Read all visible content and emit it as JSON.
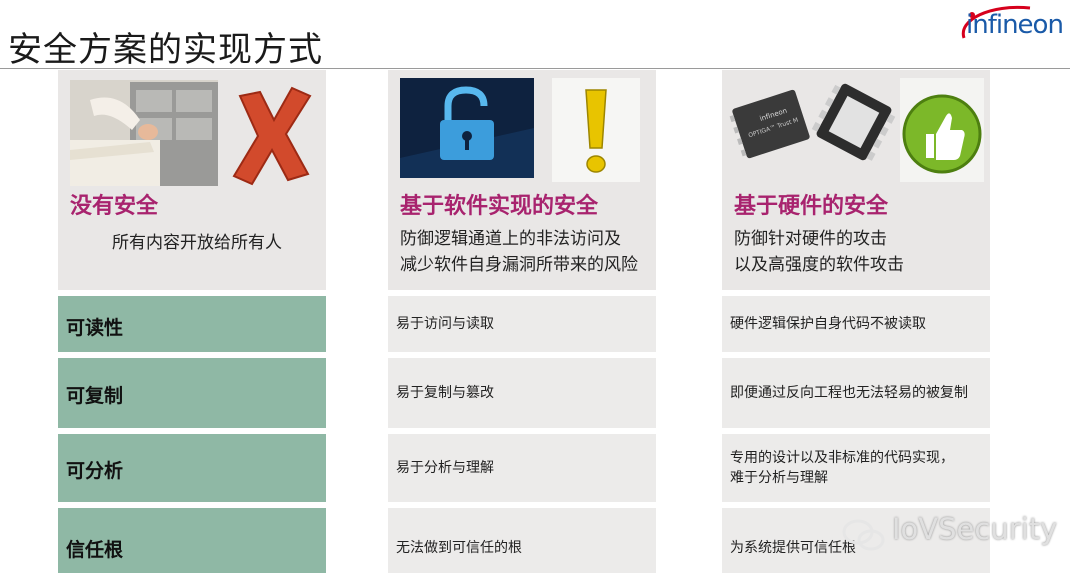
{
  "page": {
    "title": "安全方案的实现方式"
  },
  "logo": {
    "text": "infineon"
  },
  "columns": [
    {
      "heading": "没有安全",
      "description": [
        "所有内容开放给所有人"
      ]
    },
    {
      "heading": "基于软件实现的安全",
      "description": [
        "防御逻辑通道上的非法访问及",
        "减少软件自身漏洞所带来的风险"
      ]
    },
    {
      "heading": "基于硬件的安全",
      "description": [
        "防御针对硬件的攻击",
        "以及高强度的软件攻击"
      ]
    }
  ],
  "chip_labels": {
    "brand": "infineon",
    "model": "OPTIGA™ Trust M"
  },
  "rows": [
    {
      "label": "可读性",
      "software": "易于访问与读取",
      "hardware": "硬件逻辑保护自身代码不被读取"
    },
    {
      "label": "可复制",
      "software": "易于复制与篡改",
      "hardware": "即便通过反向工程也无法轻易的被复制"
    },
    {
      "label": "可分析",
      "software": "易于分析与理解",
      "hardware": [
        "专用的设计以及非标准的代码实现，",
        "难于分析与理解"
      ]
    },
    {
      "label": "信任根",
      "software": "无法做到可信任的根",
      "hardware": "为系统提供可信任根"
    }
  ],
  "watermark": {
    "text": "IoVSecurity"
  },
  "colors": {
    "heading": "#a8236e",
    "row_label_bg": "#8fb8a5",
    "cell_bg": "#ecebea",
    "panel_bg": "#e9e7e6",
    "logo_blue": "#1a5aa8",
    "logo_red": "#d6001c"
  }
}
